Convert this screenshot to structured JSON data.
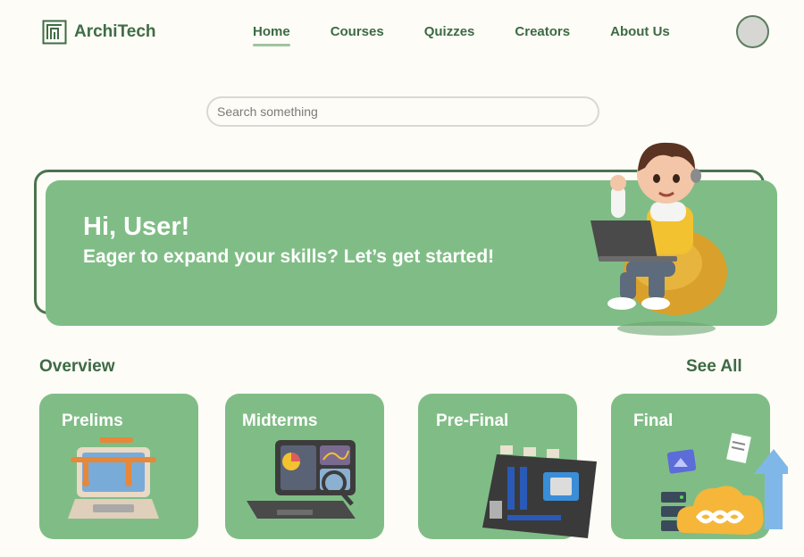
{
  "header": {
    "logo_text": "ArchiTech",
    "nav": [
      {
        "label": "Home",
        "active": true
      },
      {
        "label": "Courses"
      },
      {
        "label": "Quizzes"
      },
      {
        "label": "Creators"
      },
      {
        "label": "About Us"
      }
    ]
  },
  "search": {
    "placeholder": "Search something",
    "value": ""
  },
  "banner": {
    "greeting": "Hi, User!",
    "subtitle": "Eager to expand your skills? Let’s get started!"
  },
  "overview": {
    "title": "Overview",
    "see_all": "See All",
    "cards": [
      {
        "label": "Prelims",
        "icon": "laptop-pipes-icon"
      },
      {
        "label": "Midterms",
        "icon": "laptop-analytics-icon"
      },
      {
        "label": "Pre-Final",
        "icon": "motherboard-icon"
      },
      {
        "label": "Final",
        "icon": "cloud-infinity-icon"
      }
    ]
  },
  "colors": {
    "background": "#fdfcf7",
    "primary_green": "#80bd86",
    "dark_green": "#3d6a44",
    "white": "#ffffff"
  }
}
